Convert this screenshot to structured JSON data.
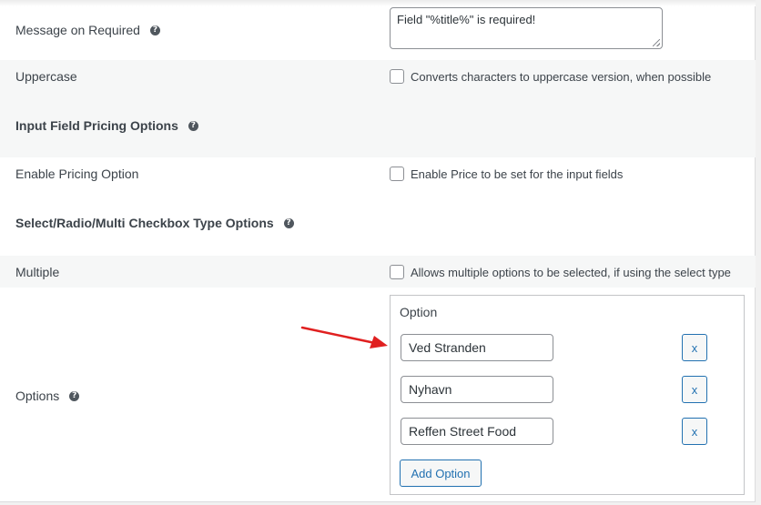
{
  "message_required": {
    "label": "Message on Required",
    "help_icon": "question-circle-icon",
    "value": "Field \"%title%\" is required!"
  },
  "uppercase": {
    "label": "Uppercase",
    "checkbox_label": "Converts characters to uppercase version, when possible",
    "checked": false
  },
  "pricing_section": {
    "heading": "Input Field Pricing Options",
    "help_icon": "question-circle-icon"
  },
  "enable_pricing": {
    "label": "Enable Pricing Option",
    "checkbox_label": "Enable Price to be set for the input fields",
    "checked": false
  },
  "select_section": {
    "heading": "Select/Radio/Multi Checkbox Type Options",
    "help_icon": "question-circle-icon"
  },
  "multiple": {
    "label": "Multiple",
    "checkbox_label": "Allows multiple options to be selected, if using the select type",
    "checked": false
  },
  "options": {
    "label": "Options",
    "help_icon": "question-circle-icon",
    "column_header": "Option",
    "items": [
      {
        "value": "Ved Stranden",
        "remove_label": "x"
      },
      {
        "value": "Nyhavn",
        "remove_label": "x"
      },
      {
        "value": "Reffen Street Food",
        "remove_label": "x"
      }
    ],
    "add_button": "Add Option"
  },
  "annotation": {
    "arrow_color": "#e02020",
    "arrow_icon": "red-arrow-icon"
  },
  "colors": {
    "accent": "#2271b1",
    "row_alt": "#f6f7f7"
  }
}
